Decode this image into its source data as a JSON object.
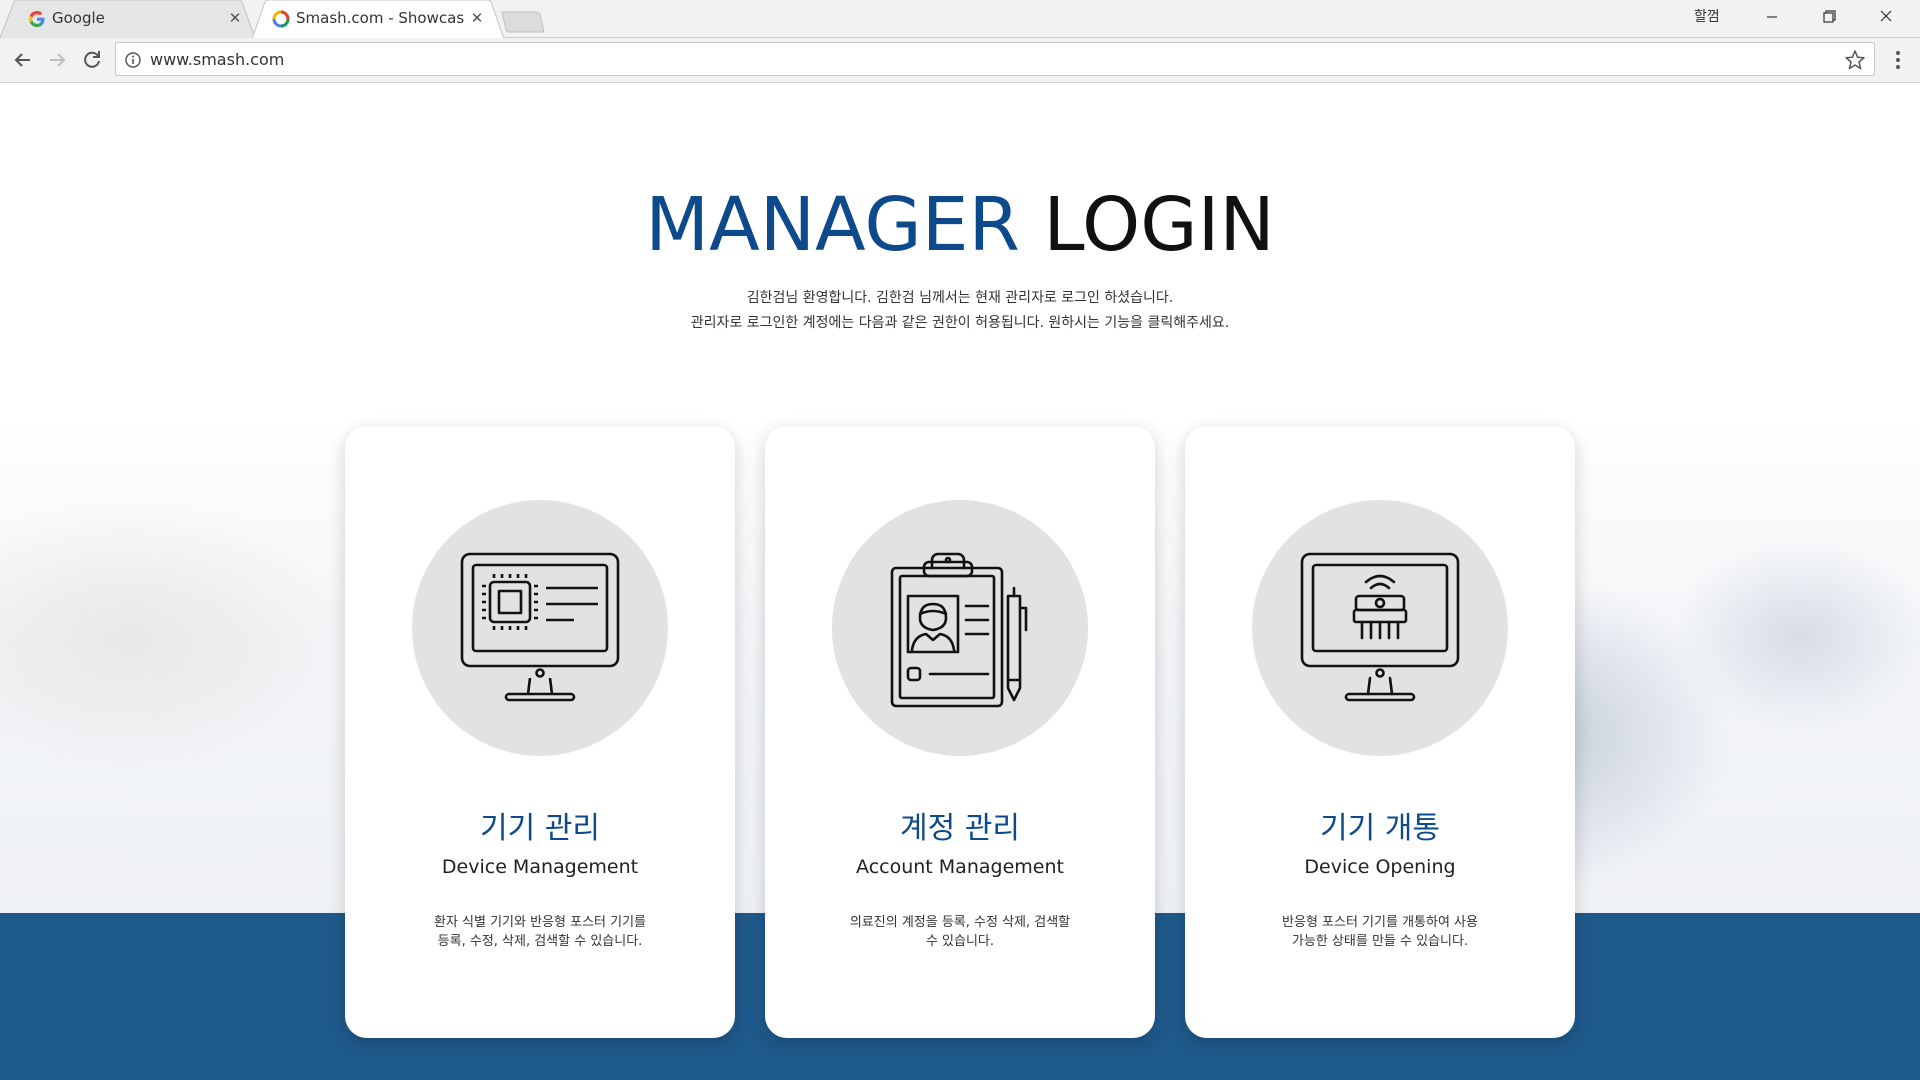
{
  "browser": {
    "tabs": [
      {
        "title": "Google",
        "favicon": "google-g-icon"
      },
      {
        "title": "Smash.com - Showcasin",
        "favicon": "chrome-loading-icon",
        "active": true
      }
    ],
    "user_label": "할껌",
    "address": "www.smash.com"
  },
  "page": {
    "headline_blue": "MANAGER",
    "headline_dark": "LOGIN",
    "intro_line1": "김한검님 환영합니다. 김한검 님께서는 현재 관리자로 로그인 하셨습니다.",
    "intro_line2": "관리자로 로그인한 계정에는 다음과 같은 권한이 허용됩니다. 원하시는 기능을 클릭해주세요.",
    "cards": [
      {
        "title_ko": "기기 관리",
        "title_en": "Device Management",
        "desc_line1": "환자 식별 기기와 반응형 포스터 기기를",
        "desc_line2": "등록, 수정, 삭제, 검색할 수 있습니다.",
        "icon": "monitor-chip-icon"
      },
      {
        "title_ko": "계정 관리",
        "title_en": "Account Management",
        "desc_line1": "의료진의 계정을 등록, 수정 삭제, 검색할",
        "desc_line2": "수 있습니다.",
        "icon": "clipboard-profile-icon"
      },
      {
        "title_ko": "기기 개통",
        "title_en": "Device Opening",
        "desc_line1": "반응형 포스터 기기를 개통하여 사용",
        "desc_line2": "가능한 상태를 만들 수 있습니다.",
        "icon": "monitor-wireless-device-icon"
      }
    ]
  },
  "colors": {
    "accent_blue": "#0d4a8c",
    "band_blue": "#1f5a8c",
    "icon_circle": "#e2e2e2"
  }
}
